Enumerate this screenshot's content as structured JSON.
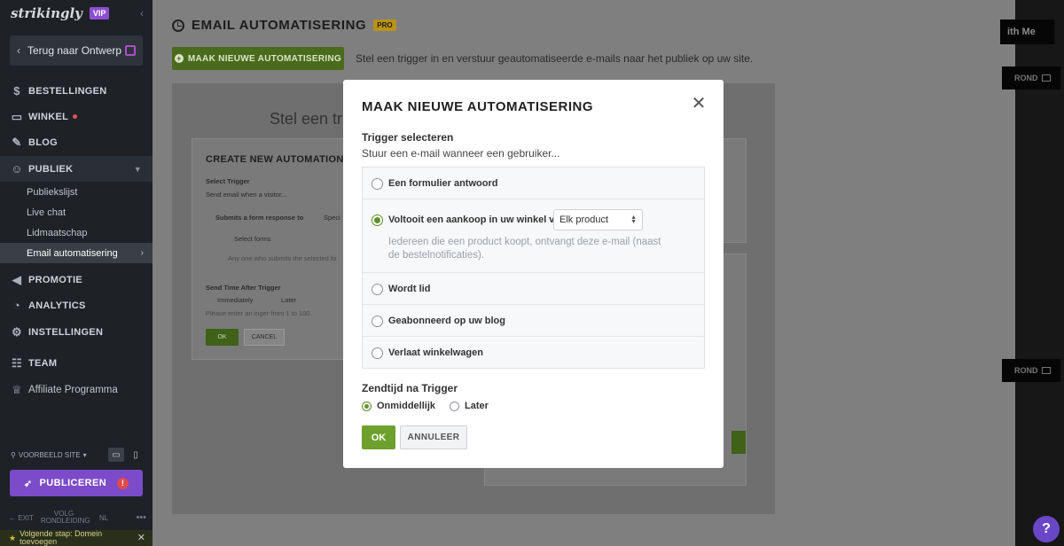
{
  "sidebar": {
    "logo": "strikingly",
    "vip_badge": "VIP",
    "back_label": "Terug naar Ontwerp",
    "nav": {
      "orders": "BESTELLINGEN",
      "store": "WINKEL",
      "blog": "BLOG",
      "audience": "PUBLIEK",
      "promotion": "PROMOTIE",
      "analytics": "ANALYTICS",
      "settings": "INSTELLINGEN",
      "team": "TEAM",
      "affiliate": "Affiliate Programma"
    },
    "audience_sub": [
      "Publiekslijst",
      "Live chat",
      "Lidmaatschap",
      "Email automatisering"
    ],
    "preview_label": "VOORBEELD SITE",
    "publish_label": "PUBLICEREN",
    "publish_alert": "!",
    "footer": {
      "exit": "EXIT",
      "guide": "VOLG RONDLEIDING",
      "lang": "NL"
    },
    "next_step": "Volgende stap: Domein toevoegen"
  },
  "header": {
    "title": "EMAIL AUTOMATISERING",
    "pro_badge": "PRO",
    "new_button": "MAAK NIEUWE AUTOMATISERING",
    "description": "Stel een trigger in en verstuur geautomatiseerde e-mails naar het publiek op uw site."
  },
  "background": {
    "heading": "Stel een trig",
    "card": {
      "title": "CREATE NEW AUTOMATION",
      "select_trigger": "Select Trigger",
      "send_when": "Send email when a visitor...",
      "option": "Submits a form response to",
      "specific": "Speci",
      "select_forms": "Select forms",
      "hint": "Any one who submits the selected fo",
      "send_time": "Send Time After Trigger",
      "immediately": "Immediately",
      "later": "Later",
      "integer_hint": "Please enter an inger from 1 to 100.",
      "ok": "OK",
      "cancel": "CANCEL"
    }
  },
  "right_preview": {
    "button": "ith Me",
    "rond1": "ROND",
    "rond2": "ROND"
  },
  "modal": {
    "title": "MAAK NIEUWE AUTOMATISERING",
    "trigger_title": "Trigger selecteren",
    "trigger_sub": "Stuur een e-mail wanneer een gebruiker...",
    "options": [
      {
        "label": "Een formulier antwoord",
        "selected": false
      },
      {
        "label": "Voltooit een aankoop in uw winkel van",
        "selected": true,
        "select_value": "Elk product",
        "description": "Iedereen die een product koopt, ontvangt deze e-mail (naast de bestelnotificaties)."
      },
      {
        "label": "Wordt lid",
        "selected": false
      },
      {
        "label": "Geabonneerd op uw blog",
        "selected": false
      },
      {
        "label": "Verlaat winkelwagen",
        "selected": false
      }
    ],
    "timing_title": "Zendtijd na Trigger",
    "timing_options": [
      "Onmiddellijk",
      "Later"
    ],
    "ok": "OK",
    "cancel": "ANNULEER"
  },
  "help": "?",
  "colors": {
    "accent_green": "#6ea02d",
    "purple": "#7c4bc9",
    "sidebar_bg": "#1e2227"
  }
}
